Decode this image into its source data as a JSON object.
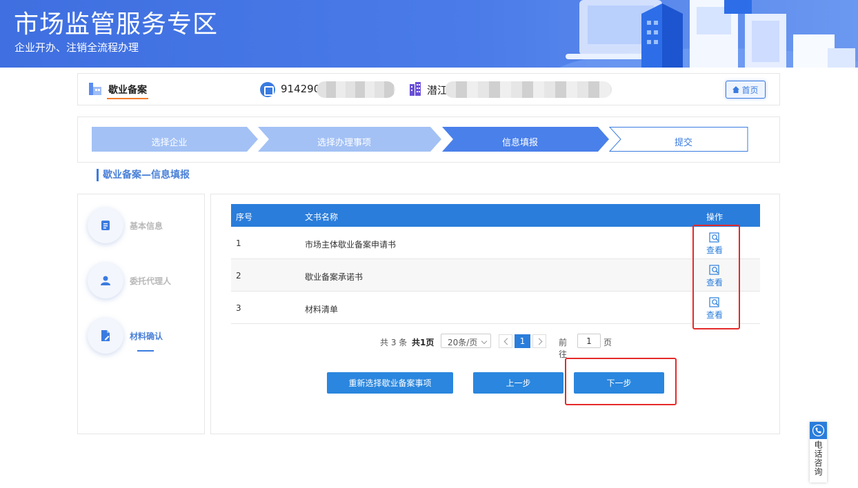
{
  "banner": {
    "title": "市场监管服务专区",
    "subtitle": "企业开办、注销全流程办理"
  },
  "header": {
    "app_title": "歇业备案",
    "credit_code": "914290",
    "region": "潜江",
    "home_label": "首页"
  },
  "steps": [
    {
      "label": "选择企业",
      "state": "done"
    },
    {
      "label": "选择办理事项",
      "state": "done"
    },
    {
      "label": "信息填报",
      "state": "current"
    },
    {
      "label": "提交",
      "state": "todo"
    }
  ],
  "section_title": "歇业备案—信息填报",
  "left_nav": [
    {
      "label": "基本信息",
      "icon": "document-icon",
      "active": false
    },
    {
      "label": "委托代理人",
      "icon": "person-icon",
      "active": false
    },
    {
      "label": "材料确认",
      "icon": "file-edit-icon",
      "active": true
    }
  ],
  "table": {
    "headers": {
      "index": "序号",
      "name": "文书名称",
      "action": "操作"
    },
    "rows": [
      {
        "index": "1",
        "name": "市场主体歇业备案申请书",
        "action": "查看"
      },
      {
        "index": "2",
        "name": "歇业备案承诺书",
        "action": "查看"
      },
      {
        "index": "3",
        "name": "材料清单",
        "action": "查看"
      }
    ]
  },
  "pagination": {
    "total_text": "共 3 条",
    "pages_text": "共1页",
    "page_size": "20条/页",
    "current_page": "1",
    "goto_label": "前往",
    "goto_value": "1",
    "goto_unit": "页"
  },
  "buttons": {
    "reselect": "重新选择歇业备案事项",
    "prev": "上一步",
    "next": "下一步"
  },
  "phone_widget": {
    "label": "电话咨询",
    "icon": "phone-icon"
  },
  "colors": {
    "primary": "#2a7ddb",
    "banner": "#4a7be8",
    "step_done": "#a3c1f5",
    "step_current": "#4a80ea",
    "highlight": "#e52a2a",
    "accent_underline": "#f07b2a"
  }
}
